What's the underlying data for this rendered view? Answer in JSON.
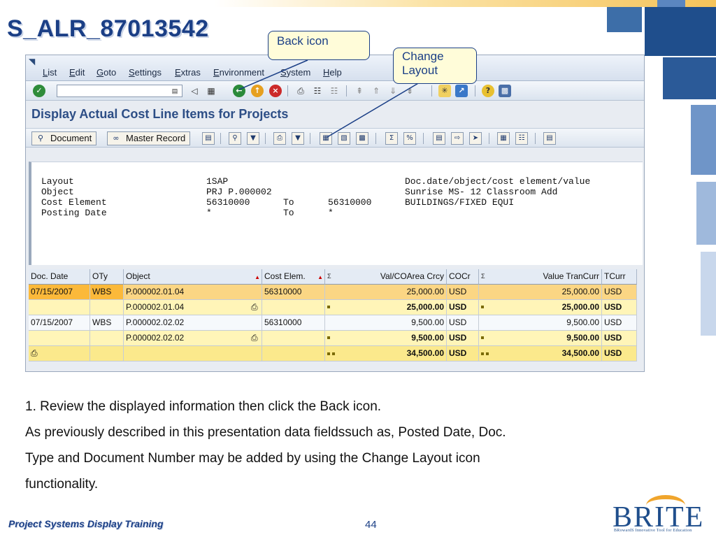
{
  "slide": {
    "title": "S_ALR_87013542",
    "footer_left": "Project Systems Display Training",
    "page_number": "44",
    "logo_text": "BRITE",
    "logo_tagline": "BRowardS Innovative Tool for Education"
  },
  "callouts": {
    "back_icon": "Back icon",
    "change_layout_line1": "Change",
    "change_layout_line2": "Layout"
  },
  "menu": {
    "items": [
      "List",
      "Edit",
      "Goto",
      "Settings",
      "Extras",
      "Environment",
      "System",
      "Help"
    ]
  },
  "screen_title": "Display Actual Cost Line Items for Projects",
  "app_toolbar": {
    "document_label": "Document",
    "master_record_label": "Master Record"
  },
  "header_panel": {
    "rows": [
      {
        "label": "Layout",
        "value": "1SAP",
        "to_label": "",
        "to_value": "",
        "desc": "Doc.date/object/cost element/value"
      },
      {
        "label": "Object",
        "value": "PRJ P.000002",
        "to_label": "",
        "to_value": "",
        "desc": "Sunrise MS- 12 Classroom Add"
      },
      {
        "label": "Cost Element",
        "value": "56310000",
        "to_label": "To",
        "to_value": "56310000",
        "desc": "BUILDINGS/FIXED EQUI"
      },
      {
        "label": "Posting Date",
        "value": "*",
        "to_label": "To",
        "to_value": "*",
        "desc": ""
      }
    ]
  },
  "grid": {
    "columns": [
      "Doc. Date",
      "OTy",
      "Object",
      "Cost Elem.",
      "Val/COArea Crcy",
      "COCr",
      "Value TranCurr",
      "TCurr"
    ],
    "rows": [
      {
        "type": "item",
        "doc_date": "07/15/2007",
        "oty": "WBS",
        "object": "P.000002.01.04",
        "cost_elem": "56310000",
        "val_coarea": "25,000.00",
        "cocr": "USD",
        "val_tran": "25,000.00",
        "tcurr": "USD"
      },
      {
        "type": "subtotal",
        "doc_date": "",
        "oty": "",
        "object": "P.000002.01.04",
        "cost_elem": "",
        "val_coarea": "25,000.00",
        "cocr": "USD",
        "val_tran": "25,000.00",
        "tcurr": "USD"
      },
      {
        "type": "item",
        "doc_date": "07/15/2007",
        "oty": "WBS",
        "object": "P.000002.02.02",
        "cost_elem": "56310000",
        "val_coarea": "9,500.00",
        "cocr": "USD",
        "val_tran": "9,500.00",
        "tcurr": "USD"
      },
      {
        "type": "subtotal",
        "doc_date": "",
        "oty": "",
        "object": "P.000002.02.02",
        "cost_elem": "",
        "val_coarea": "9,500.00",
        "cocr": "USD",
        "val_tran": "9,500.00",
        "tcurr": "USD"
      },
      {
        "type": "total",
        "doc_date": "",
        "oty": "",
        "object": "",
        "cost_elem": "",
        "val_coarea": "34,500.00",
        "cocr": "USD",
        "val_tran": "34,500.00",
        "tcurr": "USD"
      }
    ]
  },
  "body": {
    "line1": "1.  Review the displayed information then click the Back icon.",
    "line2": "As previously described in this presentation data fieldssuch as, Posted Date, Doc.",
    "line3": "Type and Document Number may be added by using the Change Layout icon",
    "line4": "functionality."
  },
  "colors": {
    "brand_blue": "#1b3f86",
    "selected_row": "#fbd684",
    "subtotal_row": "#fff5b8",
    "total_row": "#fbe98c"
  }
}
